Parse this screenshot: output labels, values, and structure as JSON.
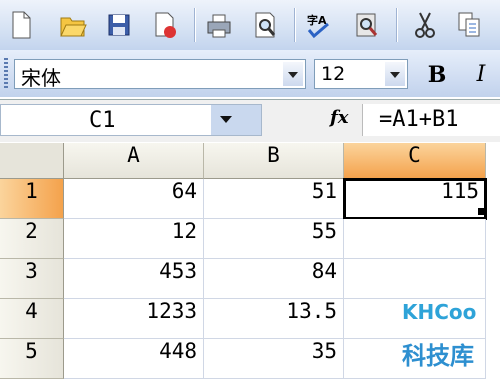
{
  "toolbar": {
    "buttons": [
      "new-file-icon",
      "open-folder-icon",
      "save-icon",
      "permission-icon",
      "print-icon",
      "print-preview-icon",
      "spelling-icon",
      "research-icon",
      "cut-icon",
      "copy-icon"
    ]
  },
  "format": {
    "font": "宋体",
    "size": "12",
    "bold": "B",
    "italic": "I"
  },
  "formula_bar": {
    "name_box": "C1",
    "fx": "fx",
    "formula": "=A1+B1"
  },
  "sheet": {
    "columns": [
      "A",
      "B",
      "C"
    ],
    "rows": [
      {
        "num": "1",
        "a": "64",
        "b": "51",
        "c": "115"
      },
      {
        "num": "2",
        "a": "12",
        "b": "55",
        "c": ""
      },
      {
        "num": "3",
        "a": "453",
        "b": "84",
        "c": ""
      },
      {
        "num": "4",
        "a": "1233",
        "b": "13.5",
        "c": ""
      },
      {
        "num": "5",
        "a": "448",
        "b": "35",
        "c": ""
      }
    ]
  },
  "watermark": {
    "logo": "KHCoo",
    "text": "科技库"
  },
  "colors": {
    "selected_header": "#f4a24c",
    "grid_line": "#d0d7e5"
  }
}
